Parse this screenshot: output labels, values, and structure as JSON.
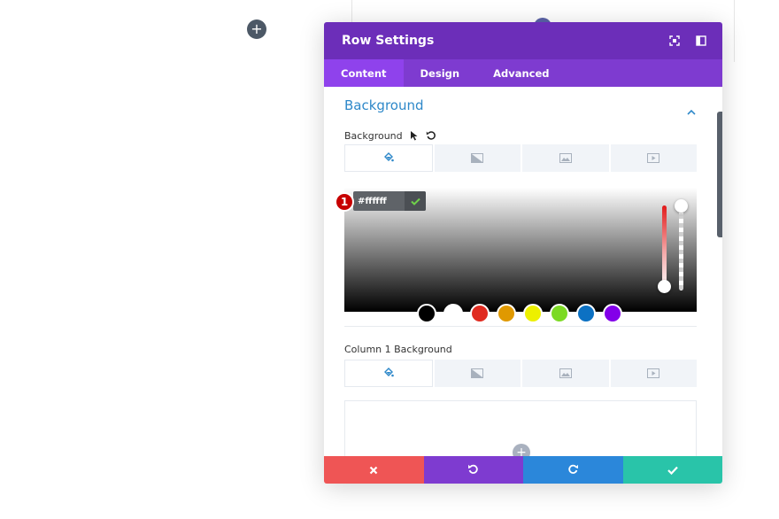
{
  "modal": {
    "title": "Row Settings",
    "tabs": [
      {
        "label": "Content",
        "active": true
      },
      {
        "label": "Design",
        "active": false
      },
      {
        "label": "Advanced",
        "active": false
      }
    ]
  },
  "section": {
    "title": "Background"
  },
  "background": {
    "label": "Background",
    "hex_value": "#ffffff",
    "marker_number": "1",
    "swatches": [
      "#000000",
      "#ffffff",
      "#e02b20",
      "#e09900",
      "#edf000",
      "#7cda24",
      "#0c71c3",
      "#8300e9"
    ]
  },
  "column1": {
    "label": "Column 1 Background"
  },
  "colors": {
    "header": "#6c2eb9",
    "tabs": "#7e3bd0",
    "tab_active": "#8f42ec",
    "section_title": "#2e88c9",
    "cancel": "#ef5555",
    "undo": "#7e3bd0",
    "redo": "#2b87da",
    "save": "#29c4a9"
  },
  "icons": {
    "expand": "fullscreen-icon",
    "sidebar": "sidebar-icon",
    "cursor": "cursor-icon",
    "reset": "reset-icon",
    "color": "paint-bucket-icon",
    "gradient": "gradient-icon",
    "image": "image-icon",
    "video": "video-icon"
  }
}
